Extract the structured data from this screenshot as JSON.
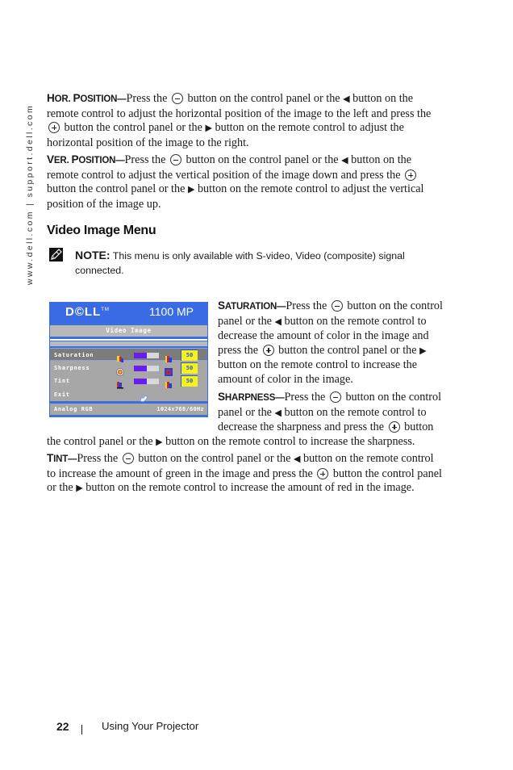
{
  "sidebar": {
    "url_text": "www.dell.com | support.dell.com"
  },
  "hor_position": {
    "term_cap": "H",
    "term_rest": "OR. ",
    "term_cap2": "P",
    "term_rest2": "OSITION",
    "dash": "—",
    "t1": "Press the",
    "t2": "button on the control panel or the",
    "t3": "button on the remote control to adjust the horizontal position of the image to the left and press the",
    "t4": "button the control panel or the",
    "t5": "button on the remote control to adjust the horizontal position of the image to the right."
  },
  "ver_position": {
    "term_cap": "V",
    "term_rest": "ER. ",
    "term_cap2": "P",
    "term_rest2": "OSITION",
    "dash": "—",
    "t1": "Press the",
    "t2": "button on the control panel or the",
    "t3": "button on the remote control to adjust the vertical position of the image down and press the",
    "t4": "button the control panel or the",
    "t5": "button on the remote control to adjust the vertical position of the image up."
  },
  "section_title": "Video Image Menu",
  "note": {
    "label": "NOTE:",
    "text": "This menu is only available with S-video, Video (composite) signal connected."
  },
  "osd": {
    "brand": "D©LL",
    "tm": "TM",
    "model": "1100 MP",
    "title": "Video Image",
    "rows": [
      {
        "label": "Saturation",
        "value": "50",
        "level": 0.5,
        "selected": true
      },
      {
        "label": "Sharpness",
        "value": "50",
        "level": 0.5,
        "selected": false
      },
      {
        "label": "Tint",
        "value": "50",
        "level": 0.5,
        "selected": false
      }
    ],
    "exit_label": "Exit",
    "footer_source": "Analog RGB",
    "footer_resolution": "1024x768/60Hz",
    "colors": {
      "frame": "#3b6fe0",
      "panel": "#a7a7a7",
      "bar_fill": "#6a1cf0",
      "value_bg": "#f5f11c"
    }
  },
  "saturation": {
    "term_cap": "S",
    "term_rest": "ATURATION",
    "dash": "—",
    "t1": "Press the",
    "t2": "button on the control panel or the",
    "t3": "button on the remote control to decrease the amount of color in the image and press the",
    "t4": "button the control panel or the",
    "t5": "button on the remote control to increase the amount of color in the image."
  },
  "sharpness": {
    "term_cap": "S",
    "term_rest": "HARPNESS",
    "dash": "—",
    "t1": "Press the",
    "t2": "button on the control panel or the",
    "t3": "button on the remote control to decrease the sharpness and press the",
    "t4": "button the control panel or the",
    "t5": "button on the remote control to increase the sharpness."
  },
  "tint": {
    "term_cap": "T",
    "term_rest": "INT",
    "dash": "—",
    "t1": "Press the",
    "t2": "button on the control panel or the",
    "t3": "button on the remote control to increase the amount of green in the image and press the",
    "t4": "button the control panel or the",
    "t5": "button on the remote control to increase the amount of red in the image."
  },
  "footer": {
    "page_number": "22",
    "chapter": "Using Your Projector"
  }
}
